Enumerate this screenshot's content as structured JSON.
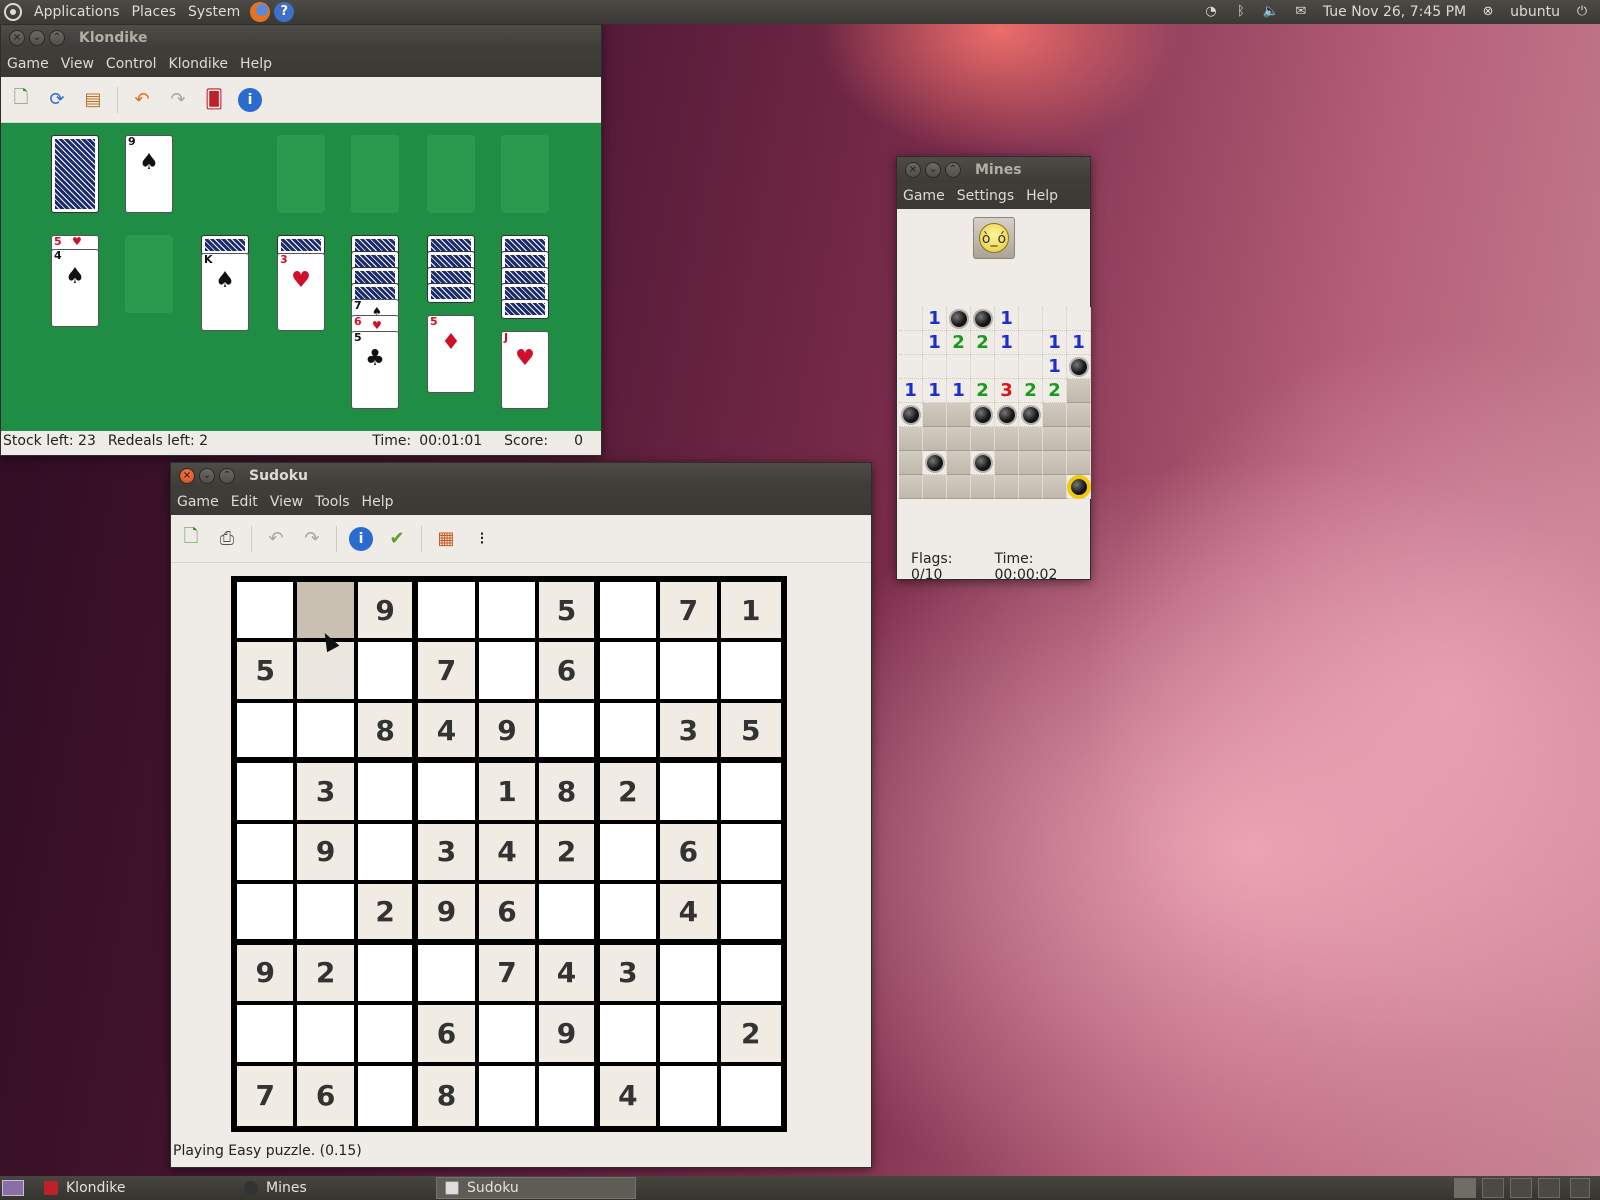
{
  "top_panel": {
    "menus": [
      "Applications",
      "Places",
      "System"
    ],
    "clock": "Tue Nov 26,  7:45 PM",
    "user": "ubuntu"
  },
  "klondike": {
    "title": "Klondike",
    "menus": [
      "Game",
      "View",
      "Control",
      "Klondike",
      "Help"
    ],
    "status": {
      "stock": "Stock left: 23",
      "redeals": "Redeals left: 2",
      "time_label": "Time:",
      "time": "00:01:01",
      "score_label": "Score:",
      "score": "0"
    },
    "waste": {
      "rank": "9",
      "suit": "♠"
    },
    "tableau": [
      {
        "rank": "5",
        "suit": "♥"
      },
      {
        "rank": "4",
        "suit": "♠"
      },
      {
        "rank": "K",
        "suit": "♠"
      },
      {
        "rank": "3",
        "suit": "♥"
      },
      {
        "rank": "7",
        "suit": "♠"
      },
      {
        "rank": "6",
        "suit": "♥"
      },
      {
        "rank": "5",
        "suit": "♣"
      },
      {
        "rank": "5",
        "suit": "♦"
      },
      {
        "rank": "J",
        "suit": "♥"
      }
    ]
  },
  "mines": {
    "title": "Mines",
    "menus": [
      "Game",
      "Settings",
      "Help"
    ],
    "flags": "Flags: 0/10",
    "time": "Time: 00:00:02",
    "grid": [
      [
        ".",
        "1",
        "M",
        "M",
        "1",
        ".",
        ".",
        "."
      ],
      [
        ".",
        "1",
        "2",
        "2",
        "1",
        ".",
        "1",
        "1"
      ],
      [
        ".",
        ".",
        ".",
        ".",
        ".",
        ".",
        "1",
        "M"
      ],
      [
        "1",
        "1",
        "1",
        "2",
        "3",
        "2",
        "2",
        "#"
      ],
      [
        "M",
        "#",
        "#",
        "M",
        "M",
        "M",
        "#",
        "#"
      ],
      [
        "#",
        "#",
        "#",
        "#",
        "#",
        "#",
        "#",
        "#"
      ],
      [
        "#",
        "M",
        "#",
        "M",
        "#",
        "#",
        "#",
        "#"
      ],
      [
        "#",
        "#",
        "#",
        "#",
        "#",
        "#",
        "#",
        "X"
      ]
    ]
  },
  "sudoku": {
    "title": "Sudoku",
    "menus": [
      "Game",
      "Edit",
      "View",
      "Tools",
      "Help"
    ],
    "status": "Playing Easy puzzle. (0.15)",
    "selected": [
      0,
      1
    ],
    "grid": [
      [
        "",
        "",
        "9",
        "",
        "",
        "5",
        "",
        "7",
        "1"
      ],
      [
        "5",
        "",
        "",
        "7",
        "",
        "6",
        "",
        "",
        ""
      ],
      [
        "",
        "",
        "8",
        "4",
        "9",
        "",
        "",
        "3",
        "5"
      ],
      [
        "",
        "3",
        "",
        "",
        "1",
        "8",
        "2",
        "",
        ""
      ],
      [
        "",
        "9",
        "",
        "3",
        "4",
        "2",
        "",
        "6",
        ""
      ],
      [
        "",
        "",
        "2",
        "9",
        "6",
        "",
        "",
        "4",
        ""
      ],
      [
        "9",
        "2",
        "",
        "",
        "7",
        "4",
        "3",
        "",
        ""
      ],
      [
        "",
        "",
        "",
        "6",
        "",
        "9",
        "",
        "",
        "2"
      ],
      [
        "7",
        "6",
        "",
        "8",
        "",
        "",
        "4",
        "",
        ""
      ]
    ]
  },
  "taskbar": {
    "tasks": [
      "Klondike",
      "Mines",
      "Sudoku"
    ],
    "active": "Sudoku"
  }
}
